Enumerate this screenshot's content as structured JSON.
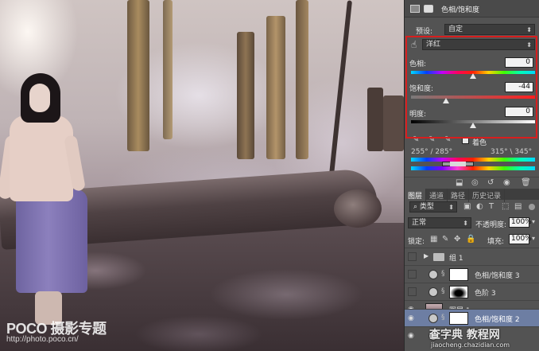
{
  "properties": {
    "title": "色相/饱和度",
    "preset_label": "预设:",
    "preset_value": "自定",
    "channel_value": "洋红",
    "hue_label": "色相:",
    "hue_value": "0",
    "sat_label": "饱和度:",
    "sat_value": "-44",
    "light_label": "明度:",
    "light_value": "0",
    "colorize_label": "着色",
    "range_left": "255° / 285°",
    "range_right": "315° \\ 345°",
    "hue_level": 0.5,
    "sat_level": 0.28,
    "light_level": 0.5
  },
  "layers_panel": {
    "tabs": [
      "图层",
      "通道",
      "路径",
      "历史记录"
    ],
    "filter_label": "类型",
    "blend_mode": "正常",
    "opacity_label": "不透明度:",
    "opacity_value": "100%",
    "lock_label": "锁定:",
    "fill_label": "填充:",
    "fill_value": "100%",
    "layers": [
      {
        "name": "组 1"
      },
      {
        "name": "色相/饱和度 3"
      },
      {
        "name": "色阶 3"
      },
      {
        "name": "图层 1"
      },
      {
        "name": "色相/饱和度 2"
      }
    ]
  },
  "watermarks": {
    "poco_brand": "POCO 摄影专题",
    "poco_url": "http://photo.poco.cn/",
    "site_brand": "查字典 教程网",
    "site_url": "jiaocheng.chazidian.com"
  }
}
